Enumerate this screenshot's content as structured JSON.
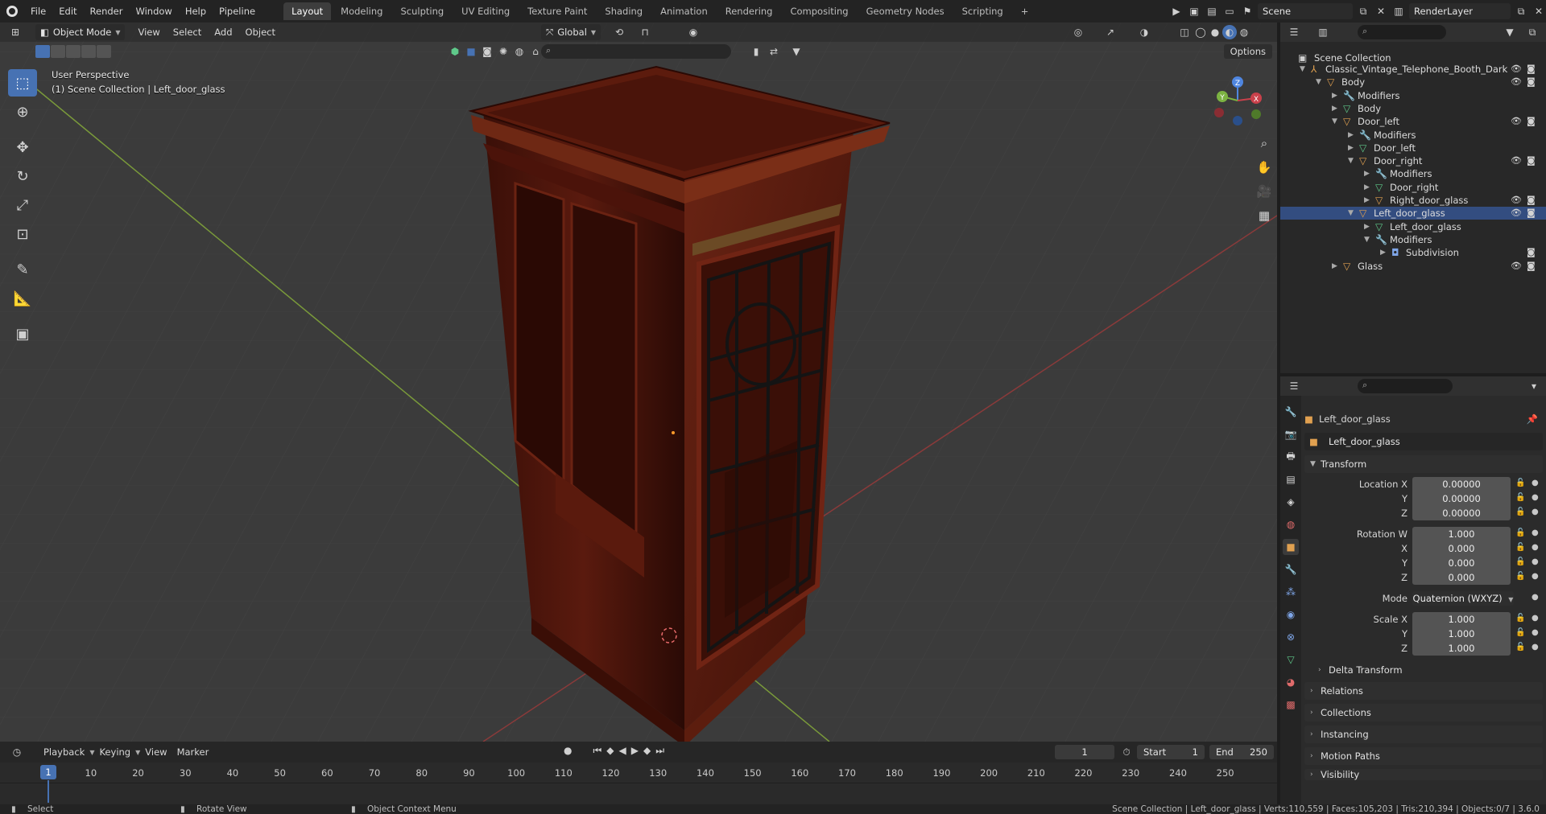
{
  "topbar": {
    "menus": [
      "File",
      "Edit",
      "Render",
      "Window",
      "Help",
      "Pipeline"
    ],
    "workspaces": [
      "Layout",
      "Modeling",
      "Sculpting",
      "UV Editing",
      "Texture Paint",
      "Shading",
      "Animation",
      "Rendering",
      "Compositing",
      "Geometry Nodes",
      "Scripting"
    ],
    "active_workspace": "Layout",
    "add_tab_icon": "+",
    "scene_name": "Scene",
    "view_layer": "RenderLayer"
  },
  "viewport": {
    "mode": "Object Mode",
    "menus": [
      "View",
      "Select",
      "Add",
      "Object"
    ],
    "transform_orientation": "Global",
    "options_label": "Options",
    "overlay_line1": "User Perspective",
    "overlay_line2": "(1) Scene Collection | Left_door_glass",
    "gizmo_axes": {
      "x": "X",
      "y": "Y",
      "z": "Z"
    }
  },
  "outliner": {
    "root": "Scene Collection",
    "rows": [
      {
        "label": "Classic_Vintage_Telephone_Booth_Dark",
        "type": "empty",
        "depth": 0,
        "expanded": true
      },
      {
        "label": "Body",
        "type": "object",
        "depth": 1,
        "expanded": true
      },
      {
        "label": "Modifiers",
        "type": "modifiers",
        "depth": 2,
        "expanded": false
      },
      {
        "label": "Body",
        "type": "mesh",
        "depth": 2,
        "expanded": false
      },
      {
        "label": "Door_left",
        "type": "object",
        "depth": 2,
        "expanded": true
      },
      {
        "label": "Modifiers",
        "type": "modifiers",
        "depth": 3,
        "expanded": false
      },
      {
        "label": "Door_left",
        "type": "mesh",
        "depth": 3,
        "expanded": false
      },
      {
        "label": "Door_right",
        "type": "object",
        "depth": 3,
        "expanded": true
      },
      {
        "label": "Modifiers",
        "type": "modifiers",
        "depth": 4,
        "expanded": false
      },
      {
        "label": "Door_right",
        "type": "mesh",
        "depth": 4,
        "expanded": false
      },
      {
        "label": "Right_door_glass",
        "type": "object",
        "depth": 4,
        "expanded": false
      },
      {
        "label": "Left_door_glass",
        "type": "object",
        "depth": 3,
        "expanded": true,
        "selected": true
      },
      {
        "label": "Left_door_glass",
        "type": "mesh",
        "depth": 4,
        "expanded": false
      },
      {
        "label": "Modifiers",
        "type": "modifiers",
        "depth": 4,
        "expanded": true
      },
      {
        "label": "Subdivision",
        "type": "modifier",
        "depth": 5,
        "expanded": false
      },
      {
        "label": "Glass",
        "type": "object",
        "depth": 2,
        "expanded": false
      }
    ]
  },
  "properties": {
    "object_name": "Left_door_glass",
    "object_field": "Left_door_glass",
    "transform_label": "Transform",
    "location": {
      "label": "Location X",
      "x": "0.00000",
      "y": "0.00000",
      "z": "0.00000"
    },
    "rotation": {
      "label": "Rotation W",
      "w": "1.000",
      "x": "0.000",
      "y": "0.000",
      "z": "0.000"
    },
    "mode": {
      "label": "Mode",
      "value": "Quaternion (WXYZ)"
    },
    "scale": {
      "label": "Scale X",
      "x": "1.000",
      "y": "1.000",
      "z": "1.000"
    },
    "axis_labels": {
      "x": "X",
      "y": "Y",
      "z": "Z"
    },
    "delta_transform": "Delta Transform",
    "relations": "Relations",
    "collections": "Collections",
    "instancing": "Instancing",
    "motion_paths": "Motion Paths",
    "visibility": "Visibility"
  },
  "timeline": {
    "menus": [
      "Playback",
      "Keying",
      "View",
      "Marker"
    ],
    "current_frame": "1",
    "start_label": "Start",
    "start": "1",
    "end_label": "End",
    "end": "250",
    "ticks": [
      "10",
      "20",
      "30",
      "40",
      "50",
      "60",
      "70",
      "80",
      "90",
      "100",
      "110",
      "120",
      "130",
      "140",
      "150",
      "160",
      "170",
      "180",
      "190",
      "200",
      "210",
      "220",
      "230",
      "240",
      "250"
    ]
  },
  "statusbar": {
    "select": "Select",
    "rotate": "Rotate View",
    "context": "Object Context Menu",
    "stats": "Scene Collection | Left_door_glass | Verts:110,559 | Faces:105,203 | Tris:210,394 | Objects:0/7 | 3.6.0"
  },
  "colors": {
    "accent": "#4772b3",
    "x_axis": "#c9414b",
    "y_axis": "#8bc34a",
    "object_icon": "#e0a050",
    "mesh_icon": "#5fc98a",
    "modifier_icon": "#7fa6e8",
    "material_icon": "#e06b6b"
  }
}
